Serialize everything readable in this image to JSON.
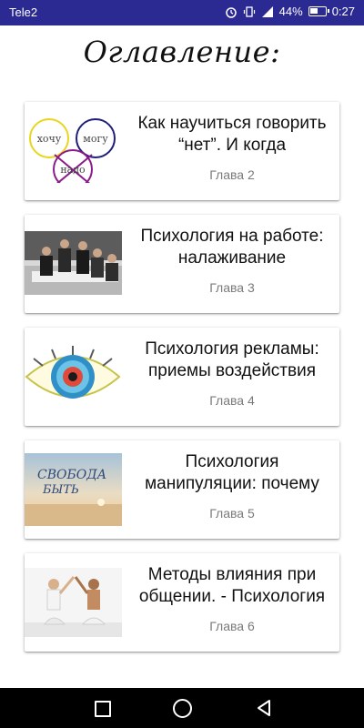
{
  "status_bar": {
    "carrier": "Tele2",
    "battery": "44%",
    "time": "0:27",
    "icons": [
      "alarm-icon",
      "vibrate-icon",
      "signal-icon",
      "battery-icon"
    ]
  },
  "page": {
    "title": "Оглавление:"
  },
  "chapters": [
    {
      "title": "Как научиться говорить “нет”. И когда",
      "subtitle": "Глава 2",
      "image_words": [
        "хочу",
        "могу",
        "надо"
      ]
    },
    {
      "title": "Психология на работе: налаживание",
      "subtitle": "Глава 3"
    },
    {
      "title": "Психология рекламы: приемы воздействия",
      "subtitle": "Глава 4"
    },
    {
      "title": "Психология манипуляции: почему",
      "subtitle": "Глава 5",
      "image_words": [
        "СВОБОДА",
        "БЫТЬ"
      ]
    },
    {
      "title": "Методы влияния при общении. - Психология",
      "subtitle": "Глава 6"
    }
  ],
  "navigation": {
    "buttons": [
      "recent-apps-icon",
      "home-icon",
      "back-icon"
    ]
  },
  "colors": {
    "status_bar": "#2b2a92",
    "subtitle": "#7a7a7a",
    "navbar": "#000000"
  }
}
